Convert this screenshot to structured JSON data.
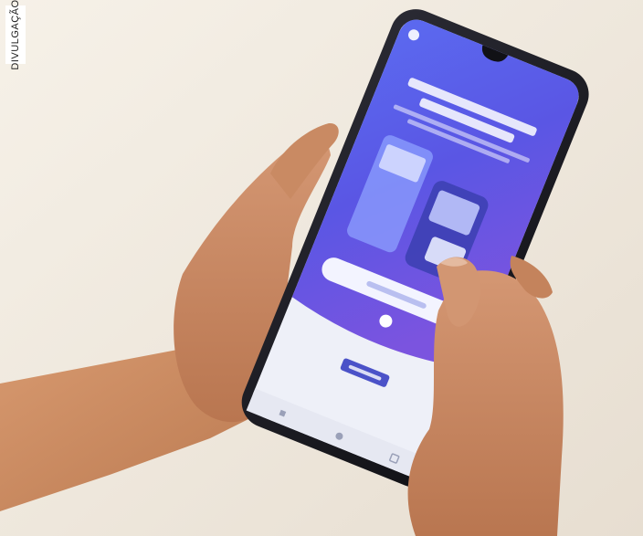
{
  "photo": {
    "credit": "DIVULGAÇÃO",
    "subject": "hands-holding-smartphone",
    "colors": {
      "background": "#efe8dd",
      "screen_blue": "#4d5fe8",
      "screen_purple": "#6b55e6",
      "phone_frame": "#1c1c22",
      "skin": "#c98b62"
    }
  }
}
